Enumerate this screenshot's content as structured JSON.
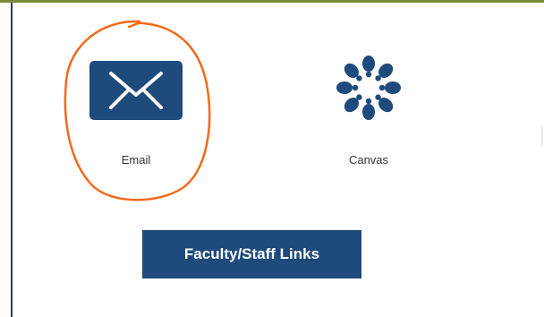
{
  "tiles": {
    "email": {
      "label": "Email",
      "icon": "envelope-icon"
    },
    "canvas": {
      "label": "Canvas",
      "icon": "canvas-logo-icon"
    }
  },
  "faculty_button": {
    "label": "Faculty/Staff Links"
  },
  "colors": {
    "brand_navy": "#1f4a7c",
    "annotation_orange": "#f26a1b",
    "top_border": "#7a8a3c"
  }
}
